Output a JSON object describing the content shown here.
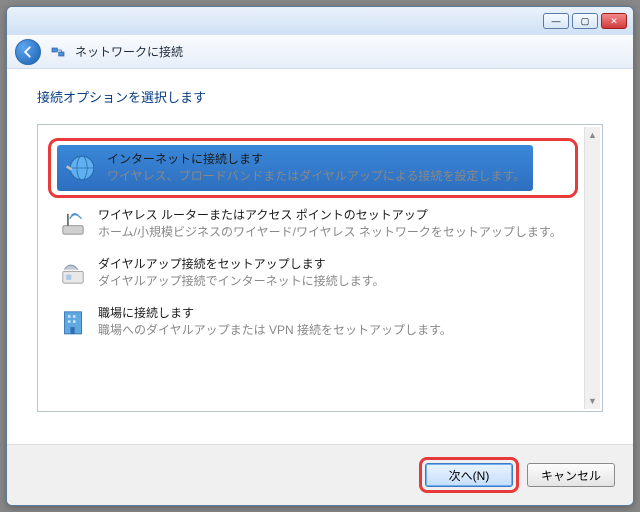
{
  "window": {
    "title": "ネットワークに接続"
  },
  "heading": "接続オプションを選択します",
  "options": [
    {
      "title": "インターネットに接続します",
      "desc": "ワイヤレス、ブロードバンドまたはダイヤルアップによる接続を設定します。"
    },
    {
      "title": "ワイヤレス ルーターまたはアクセス ポイントのセットアップ",
      "desc": "ホーム/小規模ビジネスのワイヤード/ワイヤレス ネットワークをセットアップします。"
    },
    {
      "title": "ダイヤルアップ接続をセットアップします",
      "desc": "ダイヤルアップ接続でインターネットに接続します。"
    },
    {
      "title": "職場に接続します",
      "desc": "職場へのダイヤルアップまたは VPN 接続をセットアップします。"
    }
  ],
  "buttons": {
    "next": "次へ(N)",
    "cancel": "キャンセル"
  }
}
